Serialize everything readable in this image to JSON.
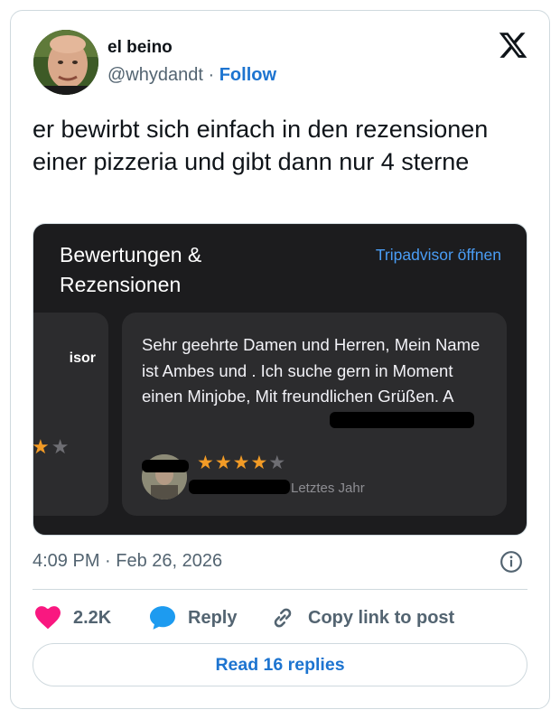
{
  "author": {
    "display_name": "el beino",
    "handle": "@whydandt",
    "separator": "·",
    "follow_label": "Follow"
  },
  "tweet": {
    "text": "er bewirbt sich einfach in den rezensionen einer pizzeria und gibt dann nur 4 sterne",
    "timestamp": "4:09 PM · Feb 26, 2026"
  },
  "media": {
    "title": "Bewertungen & Rezensionen",
    "link_label": "Tripadvisor öffnen",
    "left_card_fragment": "isor",
    "review": {
      "text": "Sehr geehrte Damen und Herren, Mein Name ist Ambes und . Ich suche gern in Moment einen Minjobe, Mit freundlichen Grüßen. A",
      "rating": 4,
      "max_rating": 5,
      "date": "Letztes Jahr"
    }
  },
  "actions": {
    "like_count": "2.2K",
    "reply_label": "Reply",
    "copy_label": "Copy link to post"
  },
  "read_replies_label": "Read 16 replies",
  "colors": {
    "link_blue": "#1d74d0",
    "like_pink": "#f91880",
    "reply_blue": "#1d9bf0",
    "star_orange": "#f29b26"
  },
  "icons": [
    "x-logo-icon",
    "heart-icon",
    "reply-bubble-icon",
    "link-icon",
    "info-icon",
    "star-icon"
  ]
}
